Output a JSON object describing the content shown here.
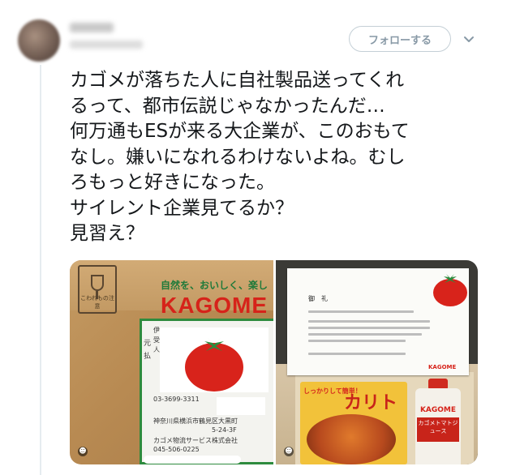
{
  "header": {
    "follow_label": "フォローする"
  },
  "tweet": {
    "lines": [
      "カゴメが落ちた人に自社製品送ってくれ",
      "るって、都市伝説じゃなかったんだ…",
      "何万通もESが来る大企業が、このおもて",
      "なし。嫌いになれるわけないよね。むし",
      "ろもっと好きになった。",
      "サイレント企業見てるか？",
      "見習え？"
    ]
  },
  "media": {
    "left": {
      "fragile_label": "こわれもの注意",
      "slogan": "自然を、おいしく、楽し",
      "brand": "KAGOME",
      "label_side": [
        "元",
        "払"
      ],
      "label_rows": [
        "伊",
        "受",
        "人",
        "03-3699-3311",
        "神奈川県横浜市鶴見区大黒町",
        "5-24-3F",
        "カゴメ物流サービス株式会社",
        "045-506-0225"
      ]
    },
    "right": {
      "letter_title": "御　礼",
      "letter_brand": "KAGOME",
      "pack_catch": "しっかりして簡単！",
      "pack_brand": "カリトマ",
      "bottle_brand": "KAGOME",
      "bottle_label": "カゴメトマトジュース"
    }
  },
  "colors": {
    "brand_red": "#d6231a",
    "brand_green": "#2e8b3e",
    "muted": "#8899a6"
  },
  "icons": {
    "chevron": "chevron-down-icon",
    "media_badge": "smile-icon"
  }
}
